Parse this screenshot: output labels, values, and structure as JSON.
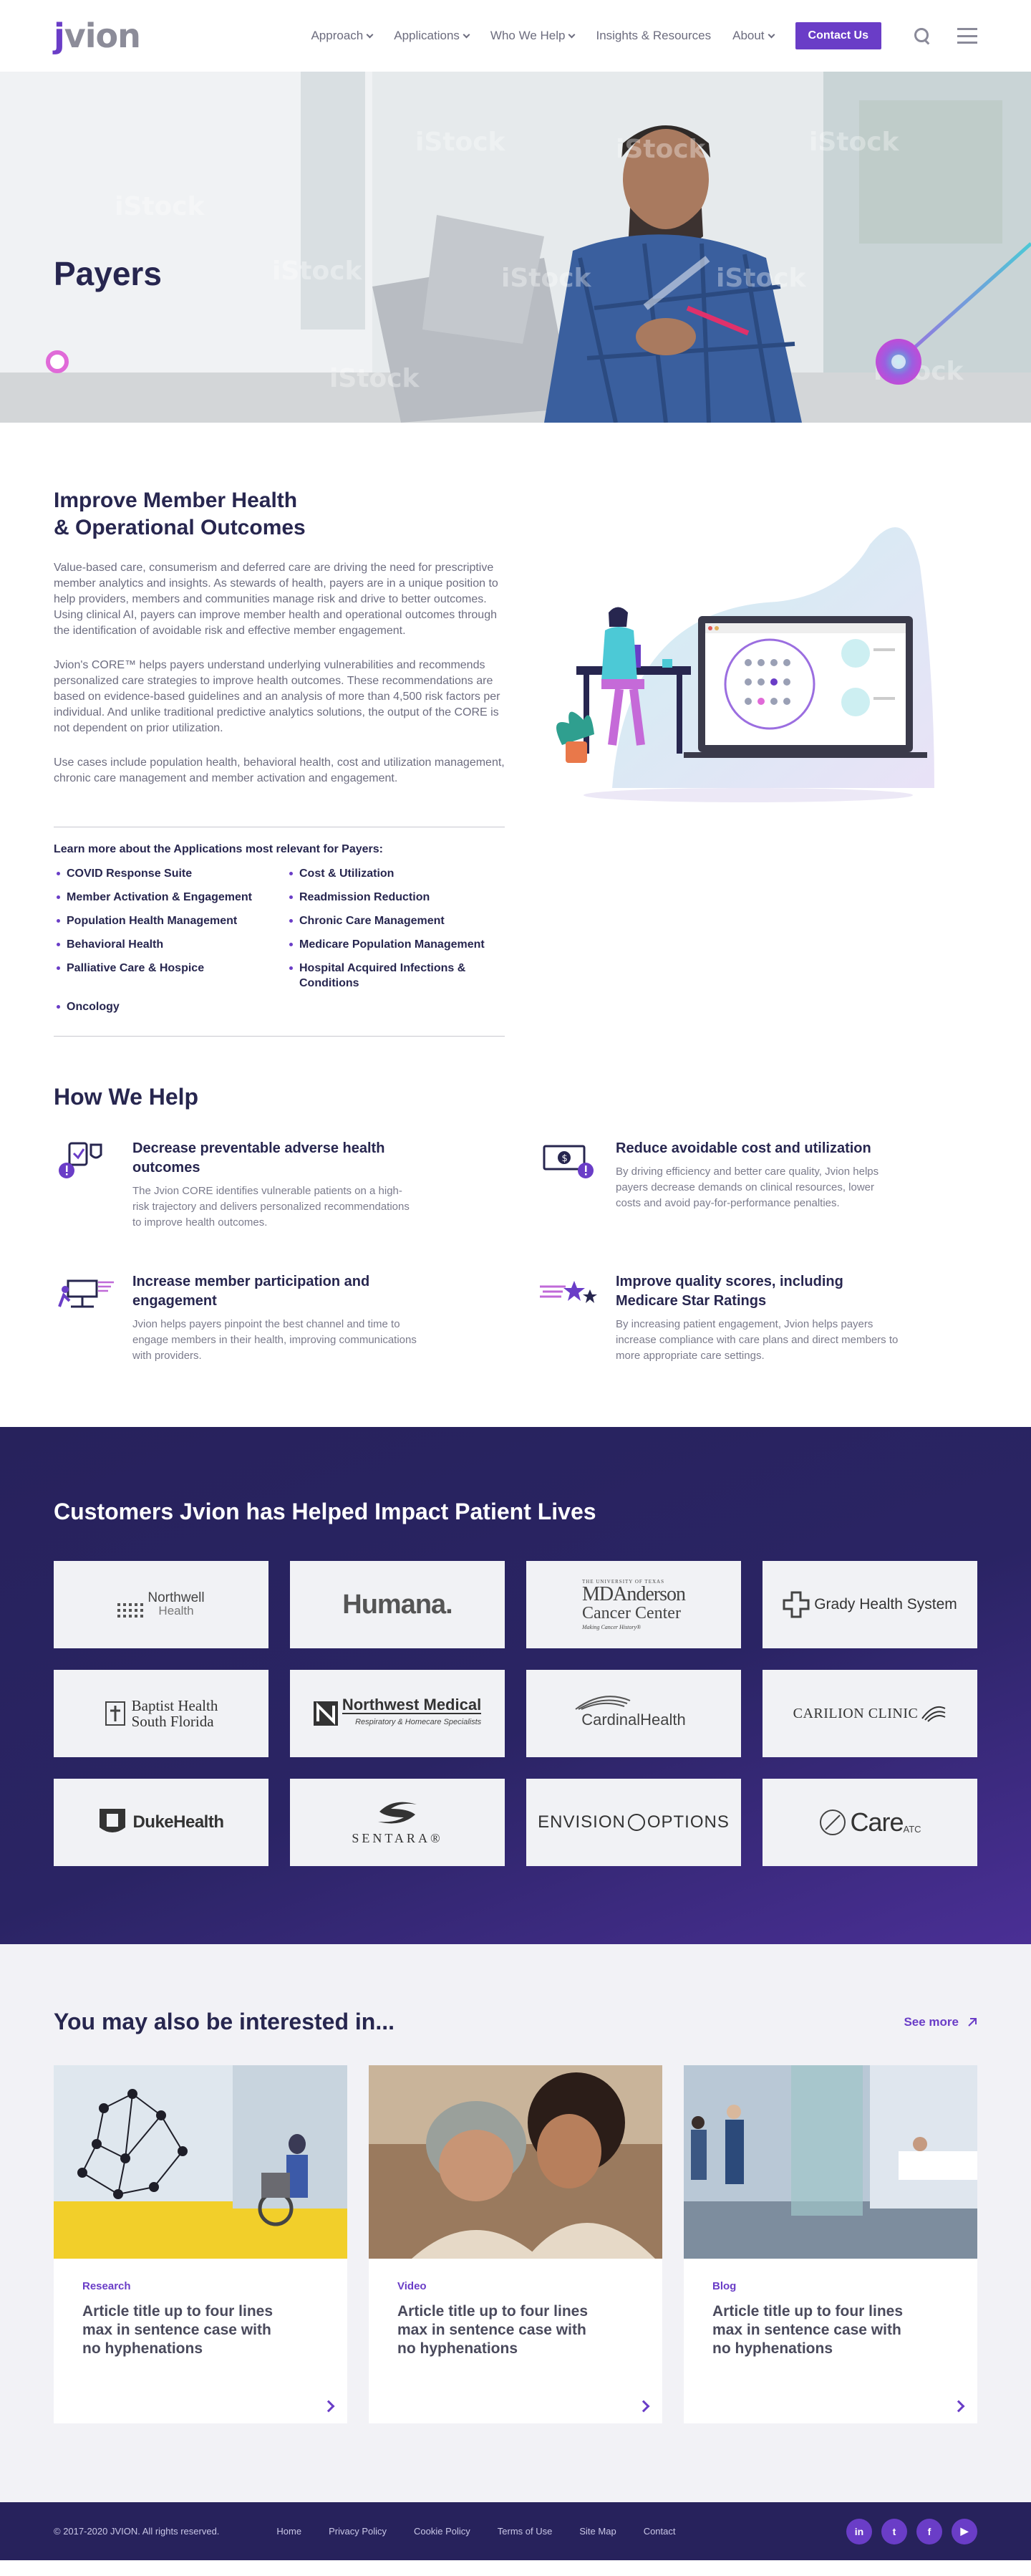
{
  "header": {
    "logo": {
      "prefix": "j",
      "rest": "vion"
    },
    "nav": [
      {
        "label": "Approach",
        "dropdown": true
      },
      {
        "label": "Applications",
        "dropdown": true
      },
      {
        "label": "Who We Help",
        "dropdown": true
      },
      {
        "label": "Insights & Resources",
        "dropdown": false
      },
      {
        "label": "About",
        "dropdown": true
      }
    ],
    "contact_label": "Contact Us",
    "icons": [
      "search-icon",
      "menu-icon"
    ]
  },
  "hero": {
    "title": "Payers",
    "watermark": "iStock"
  },
  "intro": {
    "title_line1": "Improve Member Health",
    "title_line2": "& Operational Outcomes",
    "paragraphs": [
      "Value-based care, consumerism and deferred care are driving the need for prescriptive member analytics and insights. As stewards of health, payers are in a unique position to help providers, members and communities manage risk and drive to better outcomes. Using clinical AI, payers can improve member health and operational outcomes through the identification of avoidable risk and effective member engagement.",
      "Jvion's CORE™ helps payers understand underlying vulnerabilities and recommends personalized care strategies to improve health outcomes. These recommendations are based on evidence-based guidelines and an analysis of more than 4,500 risk factors per individual. And unlike traditional predictive analytics solutions, the output of the CORE is not dependent on prior utilization.",
      "Use cases include population health, behavioral health, cost and utilization management, chronic care management and member activation and engagement."
    ],
    "apps_title": "Learn more about the Applications most relevant for Payers:",
    "apps": [
      "COVID Response Suite",
      "Cost & Utilization",
      "Member Activation & Engagement",
      "Readmission Reduction",
      "Population Health Management",
      "Chronic Care Management",
      "Behavioral Health",
      "Medicare Population Management",
      "Palliative Care & Hospice",
      "Hospital Acquired Infections & Conditions",
      "Oncology"
    ]
  },
  "how": {
    "title": "How We Help",
    "items": [
      {
        "icon": "adverse-outcome-icon",
        "title": "Decrease preventable adverse health outcomes",
        "body": "The Jvion CORE identifies vulnerable patients on a high-risk trajectory and delivers personalized recommendations to improve health outcomes."
      },
      {
        "icon": "cost-reduction-icon",
        "title": "Reduce avoidable cost and utilization",
        "body": "By driving efficiency and better care quality, Jvion helps payers decrease demands on clinical resources, lower costs and avoid pay-for-performance penalties."
      },
      {
        "icon": "member-engagement-icon",
        "title": "Increase member participation and engagement",
        "body": "Jvion helps payers pinpoint the best channel and time to engage members in their health, improving communications with providers."
      },
      {
        "icon": "star-ratings-icon",
        "title": "Improve quality scores, including Medicare Star Ratings",
        "body": "By increasing patient engagement, Jvion helps payers increase compliance with care plans and direct members to more appropriate care settings."
      }
    ]
  },
  "customers": {
    "title": "Customers Jvion has Helped Impact Patient Lives",
    "logos": [
      {
        "name": "Northwell",
        "sub": "Health"
      },
      {
        "name": "Humana."
      },
      {
        "name": "MDAnderson",
        "sub": "Cancer Center",
        "top": "THE UNIVERSITY OF TEXAS",
        "tag": "Making Cancer History®"
      },
      {
        "name": "Grady Health System"
      },
      {
        "name": "Baptist Health",
        "sub": "South Florida"
      },
      {
        "name": "Northwest Medical",
        "sub": "Respiratory & Homecare Specialists"
      },
      {
        "name": "CardinalHealth"
      },
      {
        "name": "CARILION CLINIC"
      },
      {
        "name": "DukeHealth"
      },
      {
        "name": "SENTARA®"
      },
      {
        "name": "ENVISION",
        "sub": "OPTIONS"
      },
      {
        "name": "Care",
        "sub": "ATC"
      }
    ]
  },
  "related": {
    "title": "You may also be interested in...",
    "see_more": "See more",
    "cards": [
      {
        "tag": "Research",
        "title": "Article title up to four lines max in sentence case with no hyphenations"
      },
      {
        "tag": "Video",
        "title": "Article title up to four lines max in sentence case with no hyphenations"
      },
      {
        "tag": "Blog",
        "title": "Article title up to four lines max in sentence case with no hyphenations"
      }
    ]
  },
  "footer": {
    "copyright": "© 2017-2020 JVION. All rights reserved.",
    "links": [
      "Home",
      "Privacy Policy",
      "Cookie Policy",
      "Terms of Use",
      "Site Map",
      "Contact"
    ],
    "social": [
      {
        "icon": "linkedin-icon",
        "glyph": "in"
      },
      {
        "icon": "twitter-icon",
        "glyph": "t"
      },
      {
        "icon": "facebook-icon",
        "glyph": "f"
      },
      {
        "icon": "youtube-icon",
        "glyph": "▶"
      }
    ]
  },
  "colors": {
    "brand": "#6a3dc7",
    "navy": "#27264f",
    "dark_band": "#27225c",
    "accent_teal": "#4cc9d6"
  }
}
